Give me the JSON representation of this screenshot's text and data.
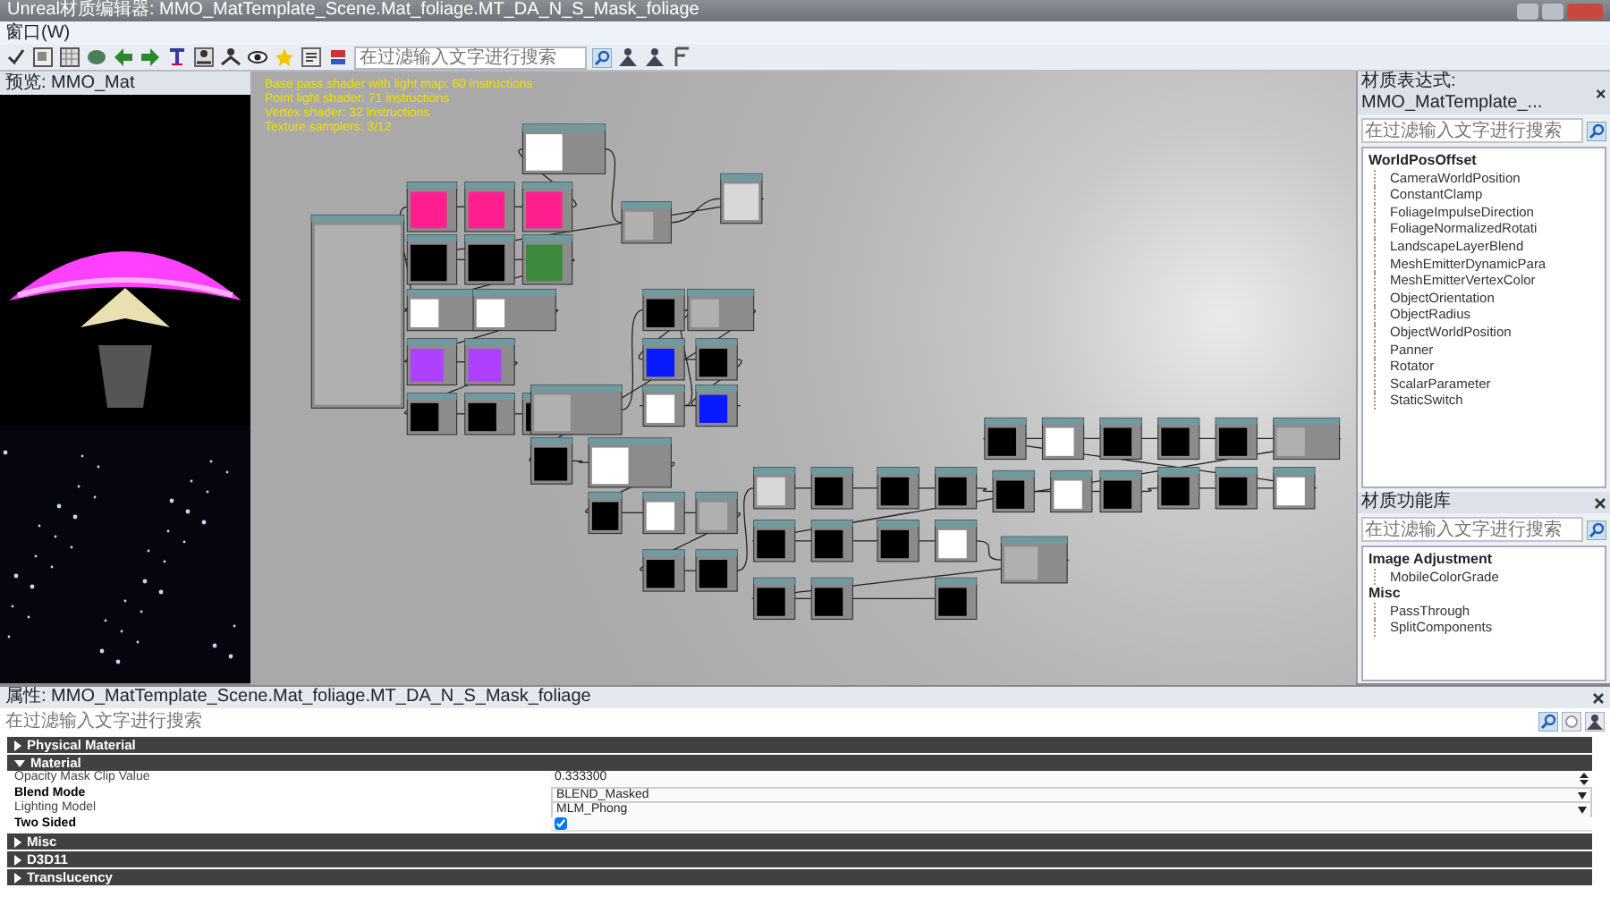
{
  "window": {
    "title": "Unreal材质编辑器: MMO_MatTemplate_Scene.Mat_foliage.MT_DA_N_S_Mask_foliage"
  },
  "menu": [
    "窗口(W)"
  ],
  "toolbar": {
    "search": {
      "placeholder": "在过滤输入文字进行搜索"
    }
  },
  "preview": {
    "tab": "预览: MMO_Mat"
  },
  "graph": {
    "stats": [
      "Base pass shader with light map: 60 instructions",
      "Point light shader: 71 instructions",
      "Vertex shader: 32 instructions",
      "Texture samplers: 3/12"
    ]
  },
  "expressions_panel": {
    "title": "材质表达式: MMO_MatTemplate_...",
    "search": {
      "placeholder": "在过滤输入文字进行搜索"
    },
    "groups": [
      {
        "label": "WorldPosOffset",
        "items": [
          "CameraWorldPosition",
          "ConstantClamp",
          "FoliageImpulseDirection",
          "FoliageNormalizedRotati",
          "LandscapeLayerBlend",
          "MeshEmitterDynamicPara",
          "MeshEmitterVertexColor",
          "ObjectOrientation",
          "ObjectRadius",
          "ObjectWorldPosition",
          "Panner",
          "Rotator",
          "ScalarParameter",
          "StaticSwitch"
        ]
      }
    ]
  },
  "functions_panel": {
    "title": "材质功能库",
    "search": {
      "placeholder": "在过滤输入文字进行搜索"
    },
    "groups": [
      {
        "label": "Image Adjustment",
        "items": [
          "MobileColorGrade"
        ]
      },
      {
        "label": "Misc",
        "items": [
          "PassThrough",
          "SplitComponents"
        ]
      }
    ]
  },
  "properties": {
    "title": "属性: MMO_MatTemplate_Scene.Mat_foliage.MT_DA_N_S_Mask_foliage",
    "filter": {
      "placeholder": "在过滤输入文字进行搜索"
    },
    "categories": [
      {
        "label": "Physical Material",
        "expanded": false
      },
      {
        "label": "Material",
        "expanded": true,
        "rows": [
          {
            "label": "Opacity Mask Clip Value",
            "modified": false,
            "kind": "number",
            "value": "0.333300"
          },
          {
            "label": "Blend Mode",
            "modified": true,
            "kind": "select",
            "value": "BLEND_Masked"
          },
          {
            "label": "Lighting Model",
            "modified": false,
            "kind": "select",
            "value": "MLM_Phong"
          },
          {
            "label": "Two Sided",
            "modified": true,
            "kind": "checkbox",
            "checked": true
          }
        ]
      },
      {
        "label": "Misc",
        "expanded": false
      },
      {
        "label": "D3D11",
        "expanded": false
      },
      {
        "label": "Translucency",
        "expanded": false
      }
    ]
  }
}
